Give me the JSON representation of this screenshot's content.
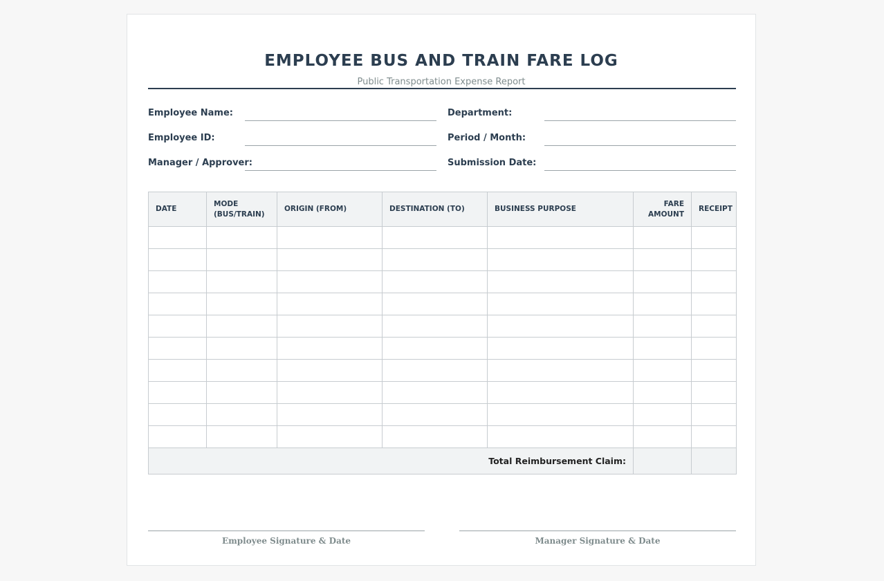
{
  "document": {
    "title": "EMPLOYEE BUS AND TRAIN FARE LOG",
    "subtitle": "Public Transportation Expense Report"
  },
  "fields": {
    "employee_name": "Employee Name:",
    "department": "Department:",
    "employee_id": "Employee ID:",
    "period_month": "Period / Month:",
    "manager_approver": "Manager / Approver:",
    "submission_date": "Submission Date:"
  },
  "table": {
    "columns": {
      "date": "DATE",
      "mode_line1": "MODE",
      "mode_line2": "(BUS/TRAIN)",
      "origin": "ORIGIN (FROM)",
      "destination": "DESTINATION (TO)",
      "purpose": "BUSINESS PURPOSE",
      "fare_line1": "FARE",
      "fare_line2": "AMOUNT",
      "receipt": "RECEIPT"
    },
    "total_label": "Total Reimbursement Claim:"
  },
  "signatures": {
    "employee": "Employee Signature & Date",
    "manager": "Manager Signature & Date"
  }
}
